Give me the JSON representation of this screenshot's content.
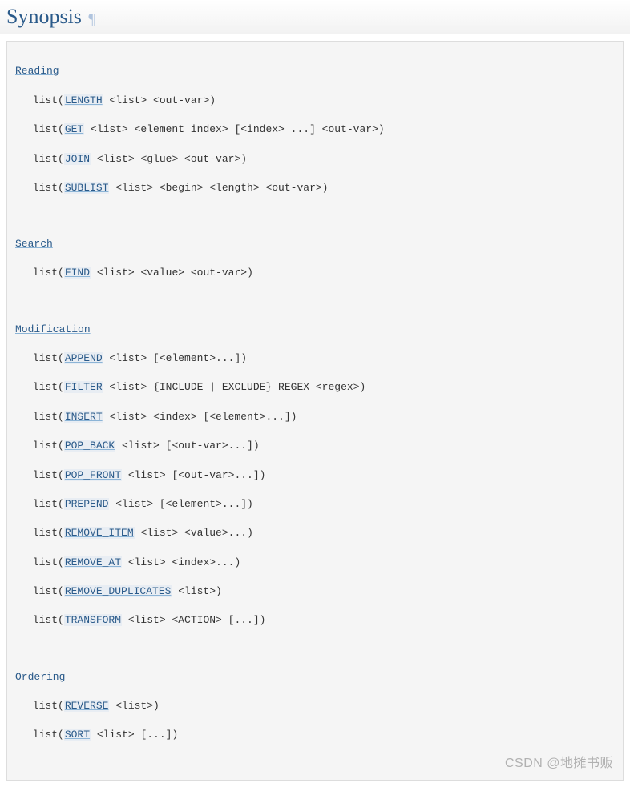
{
  "heading": "Synopsis",
  "pilcrow": "¶",
  "sections": {
    "reading": {
      "title": "Reading",
      "lines": [
        {
          "pre": " list(",
          "link": "LENGTH",
          "post": " <list> <out-var>)"
        },
        {
          "pre": " list(",
          "link": "GET",
          "post": " <list> <element index> [<index> ...] <out-var>)"
        },
        {
          "pre": " list(",
          "link": "JOIN",
          "post": " <list> <glue> <out-var>)"
        },
        {
          "pre": " list(",
          "link": "SUBLIST",
          "post": " <list> <begin> <length> <out-var>)"
        }
      ]
    },
    "search": {
      "title": "Search",
      "lines": [
        {
          "pre": " list(",
          "link": "FIND",
          "post": " <list> <value> <out-var>)"
        }
      ]
    },
    "modification": {
      "title": "Modification",
      "lines": [
        {
          "pre": " list(",
          "link": "APPEND",
          "post": " <list> [<element>...])"
        },
        {
          "pre": " list(",
          "link": "FILTER",
          "post": " <list> {INCLUDE | EXCLUDE} REGEX <regex>)"
        },
        {
          "pre": " list(",
          "link": "INSERT",
          "post": " <list> <index> [<element>...])"
        },
        {
          "pre": " list(",
          "link": "POP_BACK",
          "post": " <list> [<out-var>...])"
        },
        {
          "pre": " list(",
          "link": "POP_FRONT",
          "post": " <list> [<out-var>...])"
        },
        {
          "pre": " list(",
          "link": "PREPEND",
          "post": " <list> [<element>...])"
        },
        {
          "pre": " list(",
          "link": "REMOVE_ITEM",
          "post": " <list> <value>...)"
        },
        {
          "pre": " list(",
          "link": "REMOVE_AT",
          "post": " <list> <index>...)"
        },
        {
          "pre": " list(",
          "link": "REMOVE_DUPLICATES",
          "post": " <list>)"
        },
        {
          "pre": " list(",
          "link": "TRANSFORM",
          "post": " <list> <ACTION> [...])"
        }
      ]
    },
    "ordering": {
      "title": "Ordering",
      "lines": [
        {
          "pre": " list(",
          "link": "REVERSE",
          "post": " <list>)"
        },
        {
          "pre": " list(",
          "link": "SORT",
          "post": " <list> [...])"
        }
      ]
    }
  },
  "watermark": "CSDN @地摊书贩"
}
